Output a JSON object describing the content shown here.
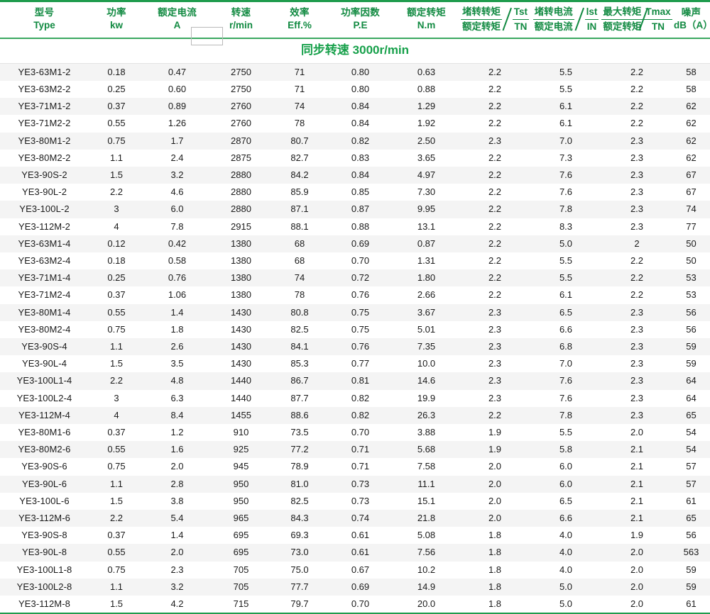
{
  "table": {
    "columns": [
      {
        "id": "type",
        "cn": "型号",
        "en": "Type",
        "kind": "plain"
      },
      {
        "id": "power",
        "cn": "功率",
        "en": "kw",
        "kind": "plain"
      },
      {
        "id": "current",
        "cn": "额定电流",
        "en": "A",
        "kind": "plain"
      },
      {
        "id": "speed",
        "cn": "转速",
        "en": "r/min",
        "kind": "plain"
      },
      {
        "id": "efficiency",
        "cn": "效率",
        "en": "Eff.%",
        "kind": "plain"
      },
      {
        "id": "power_factor",
        "cn": "功率因数",
        "en": "P.E",
        "kind": "plain"
      },
      {
        "id": "rated_torque",
        "cn": "额定转矩",
        "en": "N.m",
        "kind": "plain"
      },
      {
        "id": "tst_tn",
        "kind": "fraction",
        "num": "堵转转矩",
        "den": "额定转矩",
        "right_num": "Tst",
        "right_den": "TN"
      },
      {
        "id": "ist_in",
        "kind": "fraction",
        "num": "堵转电流",
        "den": "额定电流",
        "right_num": "lst",
        "right_den": "IN"
      },
      {
        "id": "tmax_tn",
        "kind": "fraction",
        "num": "最大转矩",
        "den": "额定转矩",
        "right_num": "Tmax",
        "right_den": "TN"
      },
      {
        "id": "noise",
        "cn": "噪声",
        "en": "dB（A）",
        "kind": "plain"
      }
    ],
    "sections": [
      {
        "title": "同步转速 3000r/min",
        "rows": [
          [
            "YE3-63M1-2",
            "0.18",
            "0.47",
            "2750",
            "71",
            "0.80",
            "0.63",
            "2.2",
            "5.5",
            "2.2",
            "58"
          ],
          [
            "YE3-63M2-2",
            "0.25",
            "0.60",
            "2750",
            "71",
            "0.80",
            "0.88",
            "2.2",
            "5.5",
            "2.2",
            "58"
          ],
          [
            "YE3-71M1-2",
            "0.37",
            "0.89",
            "2760",
            "74",
            "0.84",
            "1.29",
            "2.2",
            "6.1",
            "2.2",
            "62"
          ],
          [
            "YE3-71M2-2",
            "0.55",
            "1.26",
            "2760",
            "78",
            "0.84",
            "1.92",
            "2.2",
            "6.1",
            "2.2",
            "62"
          ],
          [
            "YE3-80M1-2",
            "0.75",
            "1.7",
            "2870",
            "80.7",
            "0.82",
            "2.50",
            "2.3",
            "7.0",
            "2.3",
            "62"
          ],
          [
            "YE3-80M2-2",
            "1.1",
            "2.4",
            "2875",
            "82.7",
            "0.83",
            "3.65",
            "2.2",
            "7.3",
            "2.3",
            "62"
          ],
          [
            "YE3-90S-2",
            "1.5",
            "3.2",
            "2880",
            "84.2",
            "0.84",
            "4.97",
            "2.2",
            "7.6",
            "2.3",
            "67"
          ],
          [
            "YE3-90L-2",
            "2.2",
            "4.6",
            "2880",
            "85.9",
            "0.85",
            "7.30",
            "2.2",
            "7.6",
            "2.3",
            "67"
          ],
          [
            "YE3-100L-2",
            "3",
            "6.0",
            "2880",
            "87.1",
            "0.87",
            "9.95",
            "2.2",
            "7.8",
            "2.3",
            "74"
          ],
          [
            "YE3-112M-2",
            "4",
            "7.8",
            "2915",
            "88.1",
            "0.88",
            "13.1",
            "2.2",
            "8.3",
            "2.3",
            "77"
          ],
          [
            "YE3-63M1-4",
            "0.12",
            "0.42",
            "1380",
            "68",
            "0.69",
            "0.87",
            "2.2",
            "5.0",
            "2",
            "50"
          ],
          [
            "YE3-63M2-4",
            "0.18",
            "0.58",
            "1380",
            "68",
            "0.70",
            "1.31",
            "2.2",
            "5.5",
            "2.2",
            "50"
          ],
          [
            "YE3-71M1-4",
            "0.25",
            "0.76",
            "1380",
            "74",
            "0.72",
            "1.80",
            "2.2",
            "5.5",
            "2.2",
            "53"
          ],
          [
            "YE3-71M2-4",
            "0.37",
            "1.06",
            "1380",
            "78",
            "0.76",
            "2.66",
            "2.2",
            "6.1",
            "2.2",
            "53"
          ],
          [
            "YE3-80M1-4",
            "0.55",
            "1.4",
            "1430",
            "80.8",
            "0.75",
            "3.67",
            "2.3",
            "6.5",
            "2.3",
            "56"
          ],
          [
            "YE3-80M2-4",
            "0.75",
            "1.8",
            "1430",
            "82.5",
            "0.75",
            "5.01",
            "2.3",
            "6.6",
            "2.3",
            "56"
          ],
          [
            "YE3-90S-4",
            "1.1",
            "2.6",
            "1430",
            "84.1",
            "0.76",
            "7.35",
            "2.3",
            "6.8",
            "2.3",
            "59"
          ],
          [
            "YE3-90L-4",
            "1.5",
            "3.5",
            "1430",
            "85.3",
            "0.77",
            "10.0",
            "2.3",
            "7.0",
            "2.3",
            "59"
          ],
          [
            "YE3-100L1-4",
            "2.2",
            "4.8",
            "1440",
            "86.7",
            "0.81",
            "14.6",
            "2.3",
            "7.6",
            "2.3",
            "64"
          ],
          [
            "YE3-100L2-4",
            "3",
            "6.3",
            "1440",
            "87.7",
            "0.82",
            "19.9",
            "2.3",
            "7.6",
            "2.3",
            "64"
          ],
          [
            "YE3-112M-4",
            "4",
            "8.4",
            "1455",
            "88.6",
            "0.82",
            "26.3",
            "2.2",
            "7.8",
            "2.3",
            "65"
          ],
          [
            "YE3-80M1-6",
            "0.37",
            "1.2",
            "910",
            "73.5",
            "0.70",
            "3.88",
            "1.9",
            "5.5",
            "2.0",
            "54"
          ],
          [
            "YE3-80M2-6",
            "0.55",
            "1.6",
            "925",
            "77.2",
            "0.71",
            "5.68",
            "1.9",
            "5.8",
            "2.1",
            "54"
          ],
          [
            "YE3-90S-6",
            "0.75",
            "2.0",
            "945",
            "78.9",
            "0.71",
            "7.58",
            "2.0",
            "6.0",
            "2.1",
            "57"
          ],
          [
            "YE3-90L-6",
            "1.1",
            "2.8",
            "950",
            "81.0",
            "0.73",
            "11.1",
            "2.0",
            "6.0",
            "2.1",
            "57"
          ],
          [
            "YE3-100L-6",
            "1.5",
            "3.8",
            "950",
            "82.5",
            "0.73",
            "15.1",
            "2.0",
            "6.5",
            "2.1",
            "61"
          ],
          [
            "YE3-112M-6",
            "2.2",
            "5.4",
            "965",
            "84.3",
            "0.74",
            "21.8",
            "2.0",
            "6.6",
            "2.1",
            "65"
          ],
          [
            "YE3-90S-8",
            "0.37",
            "1.4",
            "695",
            "69.3",
            "0.61",
            "5.08",
            "1.8",
            "4.0",
            "1.9",
            "56"
          ],
          [
            "YE3-90L-8",
            "0.55",
            "2.0",
            "695",
            "73.0",
            "0.61",
            "7.56",
            "1.8",
            "4.0",
            "2.0",
            "563"
          ],
          [
            "YE3-100L1-8",
            "0.75",
            "2.3",
            "705",
            "75.0",
            "0.67",
            "10.2",
            "1.8",
            "4.0",
            "2.0",
            "59"
          ],
          [
            "YE3-100L2-8",
            "1.1",
            "3.2",
            "705",
            "77.7",
            "0.69",
            "14.9",
            "1.8",
            "5.0",
            "2.0",
            "59"
          ],
          [
            "YE3-112M-8",
            "1.5",
            "4.2",
            "715",
            "79.7",
            "0.70",
            "20.0",
            "1.8",
            "5.0",
            "2.0",
            "61"
          ]
        ]
      }
    ]
  },
  "colors": {
    "header_green": "#118a41",
    "title_green": "#16a04a",
    "border_green": "#1f9c4d",
    "stripe": "#f4f4f4"
  }
}
